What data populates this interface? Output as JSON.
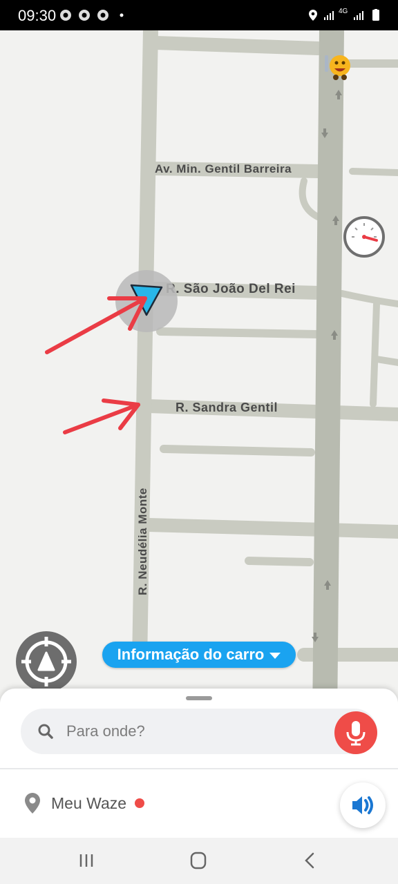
{
  "status_bar": {
    "time": "09:30",
    "network": "4G",
    "icons": [
      "chrome-icon",
      "chrome-icon",
      "chrome-icon",
      "dot-icon",
      "location-icon",
      "signal-icon",
      "signal-icon",
      "battery-icon"
    ]
  },
  "map": {
    "streets": {
      "gentil_barreira": "Av. Min. Gentil Barreira",
      "sao_joao_del_rei": "R. São João Del Rei",
      "sandra_gentil": "R. Sandra Gentil",
      "neudelia_monte": "R. Neudélia Monte"
    },
    "colors": {
      "background": "#f2f2f0",
      "road": "#c9cbc1",
      "arrow": "#ea3c45",
      "car": "#29b6e8"
    }
  },
  "info_pill": {
    "label": "Informação do carro"
  },
  "search": {
    "placeholder": "Para onde?"
  },
  "my_waze": {
    "label": "Meu Waze"
  },
  "colors": {
    "accent": "#1aa3f0",
    "mic": "#ef4c48"
  }
}
